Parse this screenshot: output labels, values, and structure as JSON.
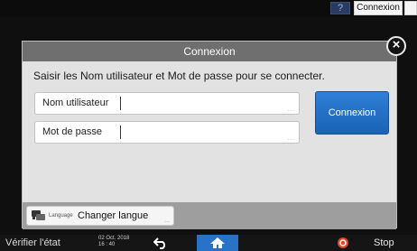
{
  "topbar": {
    "help_label": "?",
    "login_label": "Connexion",
    "moon_icon": "moon-icon"
  },
  "dialog": {
    "title": "Connexion",
    "close_label": "×",
    "instruction": "Saisir les Nom utilisateur et Mot de passe pour se connecter.",
    "username_label": "Nom utilisateur",
    "username_value": "",
    "password_label": "Mot de passe",
    "password_value": "",
    "field_more": "...",
    "connect_label": "Connexion",
    "language_small": "Language",
    "language_label": "Changer langue",
    "language_more": "..."
  },
  "bottombar": {
    "check_status": "Vérifier l'état",
    "date": "02 Oct. 2018",
    "time": "16 : 40",
    "stop_label": "Stop"
  },
  "colors": {
    "accent": "#2a72c6",
    "header": "#6f6f6f",
    "dialog_bg": "#e2e2e2",
    "stop_icon": "#e0442a"
  }
}
